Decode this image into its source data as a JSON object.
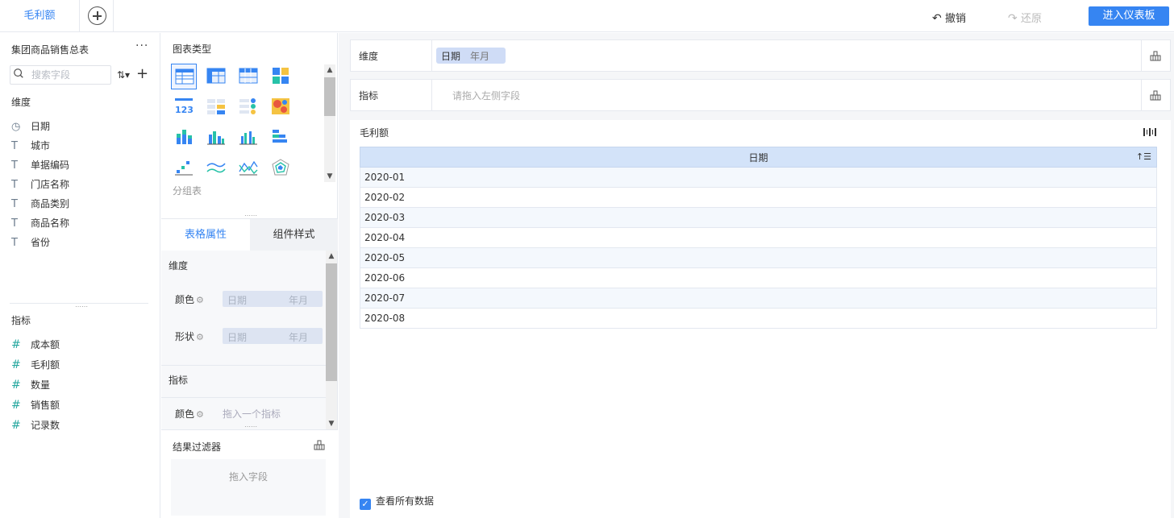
{
  "topbar": {
    "active_tab": "毛利额",
    "undo_label": "撤销",
    "redo_label": "还原",
    "enter_dashboard": "进入仪表板"
  },
  "left": {
    "dataset_title": "集团商品销售总表",
    "more": "···",
    "search_placeholder": "搜索字段",
    "dimension_title": "维度",
    "dimensions": [
      {
        "icon": "clock-icon",
        "label": "日期"
      },
      {
        "icon": "text-type-icon",
        "label": "城市"
      },
      {
        "icon": "text-type-icon",
        "label": "单据编码"
      },
      {
        "icon": "text-type-icon",
        "label": "门店名称"
      },
      {
        "icon": "text-type-icon",
        "label": "商品类别"
      },
      {
        "icon": "text-type-icon",
        "label": "商品名称"
      },
      {
        "icon": "text-type-icon",
        "label": "省份"
      }
    ],
    "measure_title": "指标",
    "measures": [
      {
        "icon": "number-type-icon",
        "label": "成本额"
      },
      {
        "icon": "number-type-icon",
        "label": "毛利额"
      },
      {
        "icon": "number-type-icon",
        "label": "数量"
      },
      {
        "icon": "number-type-icon",
        "label": "销售额"
      },
      {
        "icon": "number-type-icon",
        "label": "记录数"
      }
    ]
  },
  "mid": {
    "chart_type_title": "图表类型",
    "chart_type_name": "分组表",
    "tab_table_props": "表格属性",
    "tab_component_style": "组件样式",
    "dimension_section": "维度",
    "color_label": "颜色",
    "shape_label": "形状",
    "pill_field": "日期",
    "pill_granularity": "年月",
    "measure_section": "指标",
    "measure_color_label": "颜色",
    "measure_placeholder": "拖入一个指标",
    "filter_title": "结果过滤器",
    "filter_placeholder": "拖入字段"
  },
  "right": {
    "dimension_shelf_label": "维度",
    "dimension_pill_field": "日期",
    "dimension_pill_granularity": "年月",
    "measure_shelf_label": "指标",
    "measure_placeholder": "请拖入左侧字段",
    "result_title": "毛利额",
    "table_header": "日期",
    "rows": [
      "2020-01",
      "2020-02",
      "2020-03",
      "2020-04",
      "2020-05",
      "2020-06",
      "2020-07",
      "2020-08"
    ],
    "view_all_label": "查看所有数据"
  },
  "colors": {
    "accent": "#3685f2",
    "header_bg": "#d3e3f9",
    "measure_icon": "#27a8a0"
  }
}
